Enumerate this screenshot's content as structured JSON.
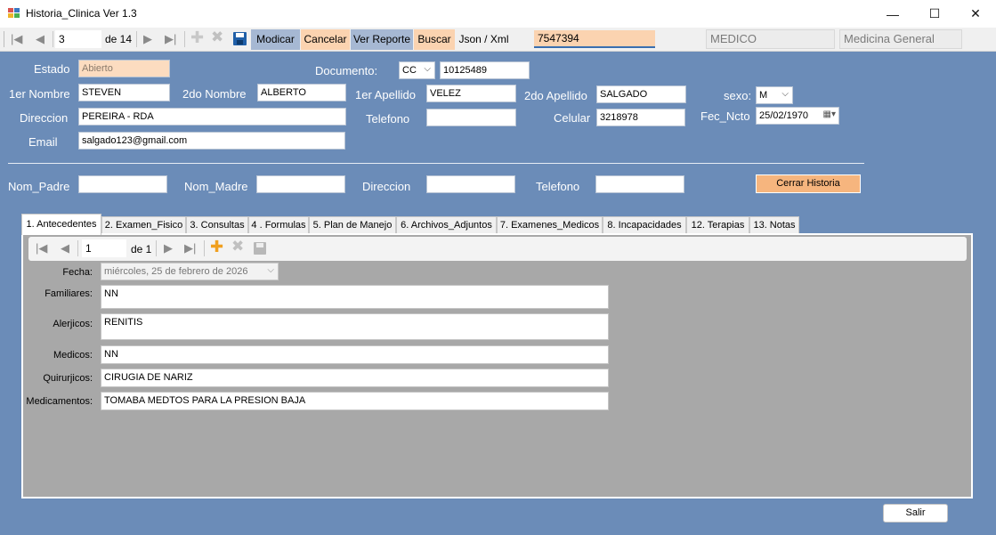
{
  "window": {
    "title": "Historia_Clinica Ver 1.3",
    "minimize_glyph": "—",
    "maximize_glyph": "☐",
    "close_glyph": "✕"
  },
  "toolbar": {
    "record_position": "3",
    "record_count": "de 14",
    "modify_label": "Modicar",
    "cancel_label": "Cancelar",
    "report_label": "Ver Reporte",
    "search_label": "Buscar",
    "json_label": "Json / Xml",
    "search_value": "7547394",
    "role_value": "MEDICO",
    "specialty_value": "Medicina General",
    "colors": {
      "modify_bg": "#a6b8d3",
      "cancel_bg": "#fbd3b0",
      "report_bg": "#a6b8d3",
      "search_bg": "#fbd3b0"
    }
  },
  "patient": {
    "estado_label": "Estado",
    "estado_value": "Abierto",
    "documento_label": "Documento:",
    "doc_type": "CC",
    "doc_number": "10125489",
    "first_name_label": "1er Nombre",
    "first_name": "STEVEN",
    "second_name_label": "2do Nombre",
    "second_name": "ALBERTO",
    "first_surname_label": "1er Apellido",
    "first_surname": "VELEZ",
    "second_surname_label": "2do Apellido",
    "second_surname": "SALGADO",
    "sex_label": "sexo:",
    "sex": "M",
    "address_label": "Direccion",
    "address": "PEREIRA - RDA",
    "phone_label": "Telefono",
    "phone": "",
    "cell_label": "Celular",
    "cell": "3218978",
    "birth_label": "Fec_Ncto",
    "birth": "25/02/1970",
    "email_label": "Email",
    "email": "salgado123@gmail.com"
  },
  "parents": {
    "father_label": "Nom_Padre",
    "father": "",
    "mother_label": "Nom_Madre",
    "mother": "",
    "address_label": "Direccion",
    "address": "",
    "phone_label": "Telefono",
    "phone": "",
    "close_history_label": "Cerrar  Historia"
  },
  "tabs": [
    {
      "label": "1. Antecedentes"
    },
    {
      "label": "2. Examen_Fisico"
    },
    {
      "label": "3. Consultas"
    },
    {
      "label": "4 . Formulas"
    },
    {
      "label": "5. Plan de Manejo"
    },
    {
      "label": "6. Archivos_Adjuntos"
    },
    {
      "label": "7. Examenes_Medicos"
    },
    {
      "label": "8. Incapacidades"
    },
    {
      "label": "12. Terapias"
    },
    {
      "label": "13. Notas"
    }
  ],
  "antecedentes": {
    "record_position": "1",
    "record_count": "de 1",
    "fecha_label": "Fecha:",
    "fecha_value": "miércoles, 25 de    febrero    de 2026",
    "familiares_label": "Familiares:",
    "familiares": "NN",
    "alergicos_label": "Alerjicos:",
    "alergicos": "RENITIS",
    "medicos_label": "Medicos:",
    "medicos": "NN",
    "quirurgicos_label": "Quirurjicos:",
    "quirurgicos": "CIRUGIA DE NARIZ",
    "medicamentos_label": "Medicamentos:",
    "medicamentos": "TOMABA MEDTOS PARA LA PRESION BAJA"
  },
  "footer": {
    "exit_label": "Salir"
  }
}
